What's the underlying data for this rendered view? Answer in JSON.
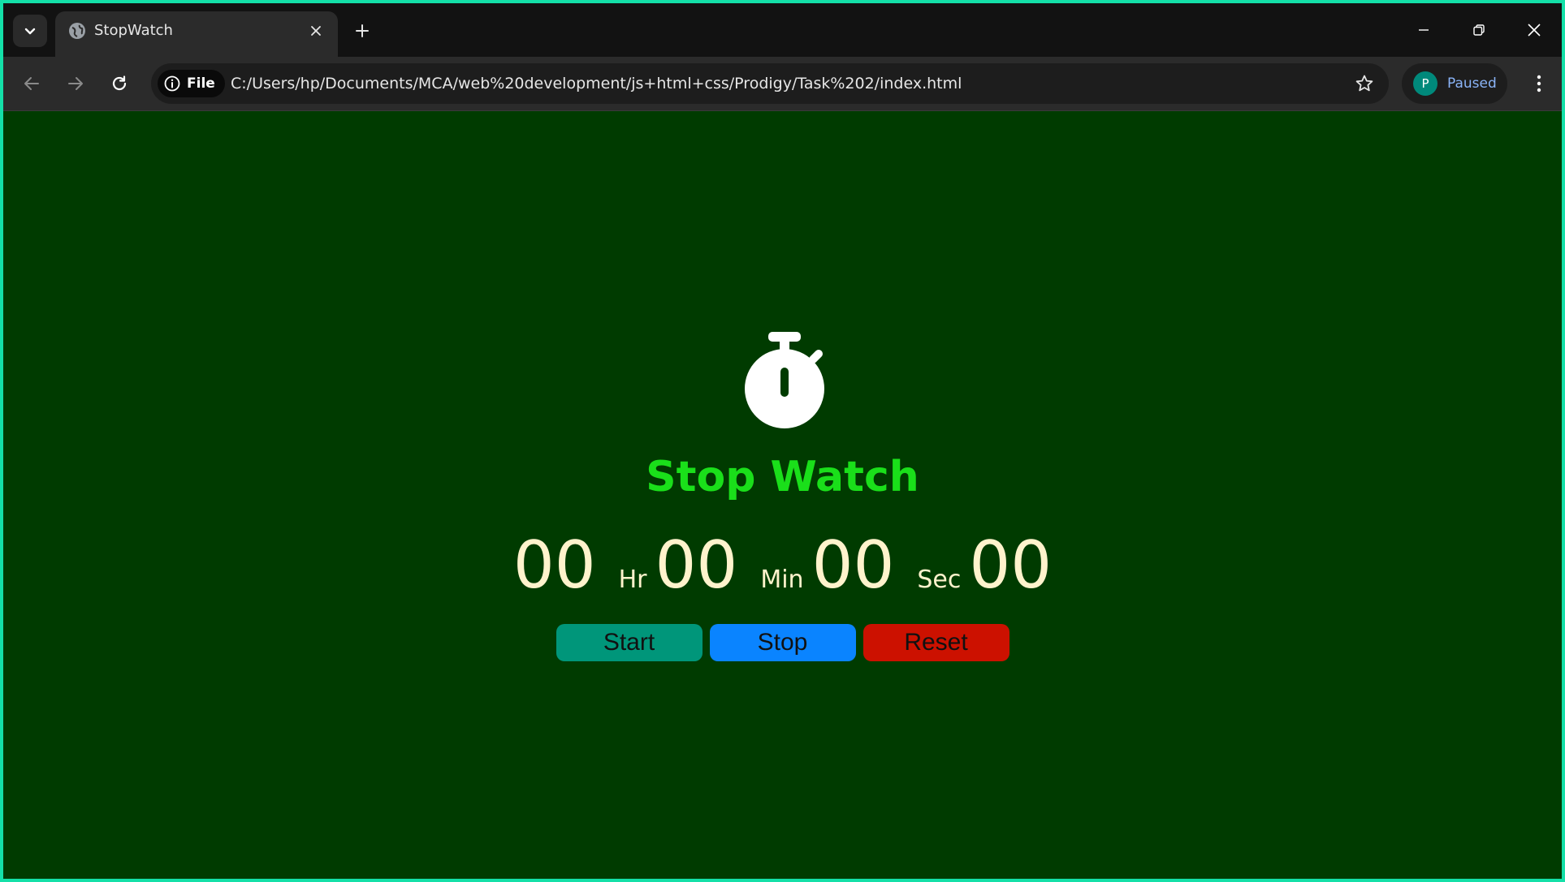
{
  "browser": {
    "tab": {
      "title": "StopWatch"
    },
    "address_bar": {
      "scheme_chip": "File",
      "url": "C:/Users/hp/Documents/MCA/web%20development/js+html+css/Prodigy/Task%202/index.html"
    },
    "profile": {
      "initial": "P",
      "status": "Paused",
      "avatar_color": "#00897b"
    }
  },
  "page": {
    "background_color": "#003b00",
    "icon": "stopwatch-icon",
    "heading": "Stop Watch",
    "heading_color": "#1adf1a",
    "timer": {
      "hours": "00",
      "hours_unit": "Hr",
      "minutes": "00",
      "minutes_unit": "Min",
      "seconds": "00",
      "seconds_unit": "Sec",
      "milliseconds": "00",
      "text_color": "#fff3cc"
    },
    "buttons": {
      "start": {
        "label": "Start",
        "color": "#00967a"
      },
      "stop": {
        "label": "Stop",
        "color": "#0a84ff"
      },
      "reset": {
        "label": "Reset",
        "color": "#cc1100"
      }
    }
  }
}
